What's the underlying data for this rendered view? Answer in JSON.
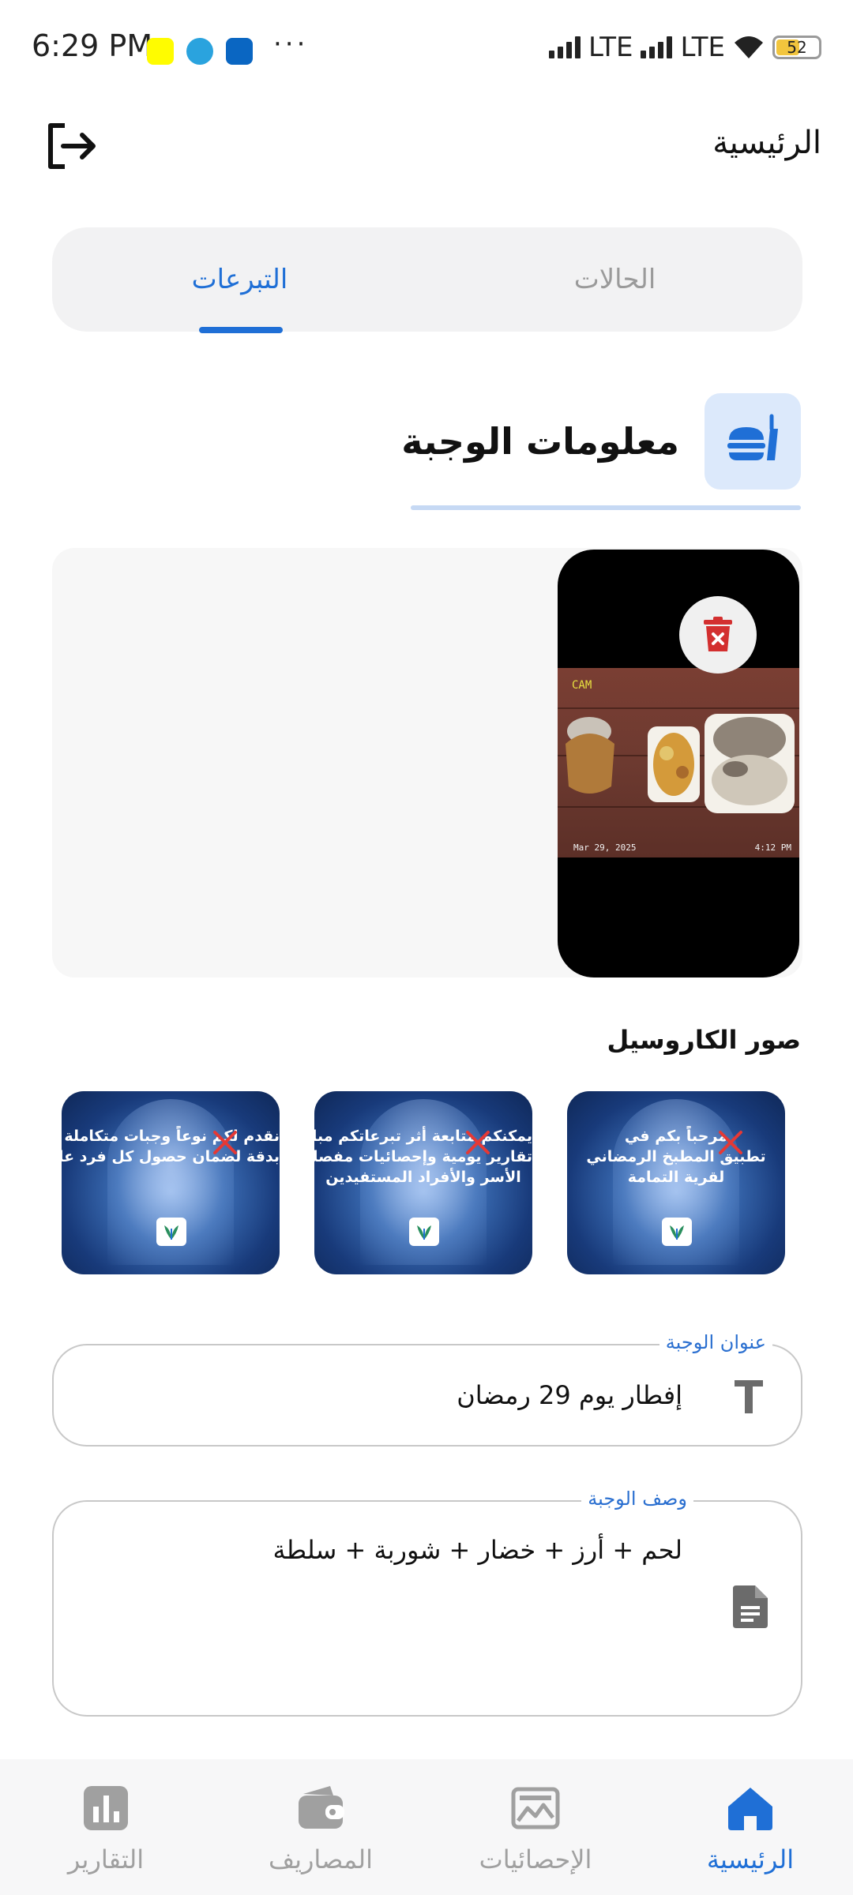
{
  "status_bar": {
    "time": "6:29 PM",
    "notification_icons": [
      "snapchat-icon",
      "telegram-icon",
      "linkedin-icon"
    ],
    "more": "···",
    "network_1": "LTE",
    "network_2": "LTE",
    "battery_level": "52"
  },
  "header": {
    "title": "الرئيسية",
    "logout_icon": "logout-icon"
  },
  "tabs": {
    "cases": "الحالات",
    "donations": "التبرعات",
    "active": "donations"
  },
  "meal_section": {
    "title": "معلومات الوجبة",
    "icon": "meal-icon"
  },
  "photo": {
    "cam_label": "CAM",
    "date": "Mar 29, 2025",
    "time": "4:12 PM"
  },
  "carousel": {
    "title": "صور الكاروسيل",
    "cards": [
      {
        "lines": [
          "مرحباً بكم في",
          "تطبيق المطبخ الرمضاني",
          "لقرية التمامة"
        ]
      },
      {
        "lines": [
          "يمكنكم متابعة أثر تبرعاتكم مباشرة",
          "تقارير يومية وإحصائيات مفصلة عن",
          "الأسر والأفراد المستفيدين"
        ]
      },
      {
        "lines": [
          "نقدم لكم نوعاً وجبات متكاملة محسوبة",
          "بدقة لضمان حصول كل فرد على حقه"
        ]
      }
    ]
  },
  "form": {
    "meal_title_label": "عنوان الوجبة",
    "meal_title_value": "إفطار يوم 29 رمضان",
    "meal_desc_label": "وصف الوجبة",
    "meal_desc_value": "لحم + أرز + خضار + شوربة + سلطة"
  },
  "bottom_nav": {
    "home": "الرئيسية",
    "statistics": "الإحصائيات",
    "expenses": "المصاريف",
    "reports": "التقارير",
    "active": "home"
  },
  "colors": {
    "accent": "#1f6fd6",
    "danger": "#d32f2f",
    "inactive": "#a0a0a0"
  }
}
